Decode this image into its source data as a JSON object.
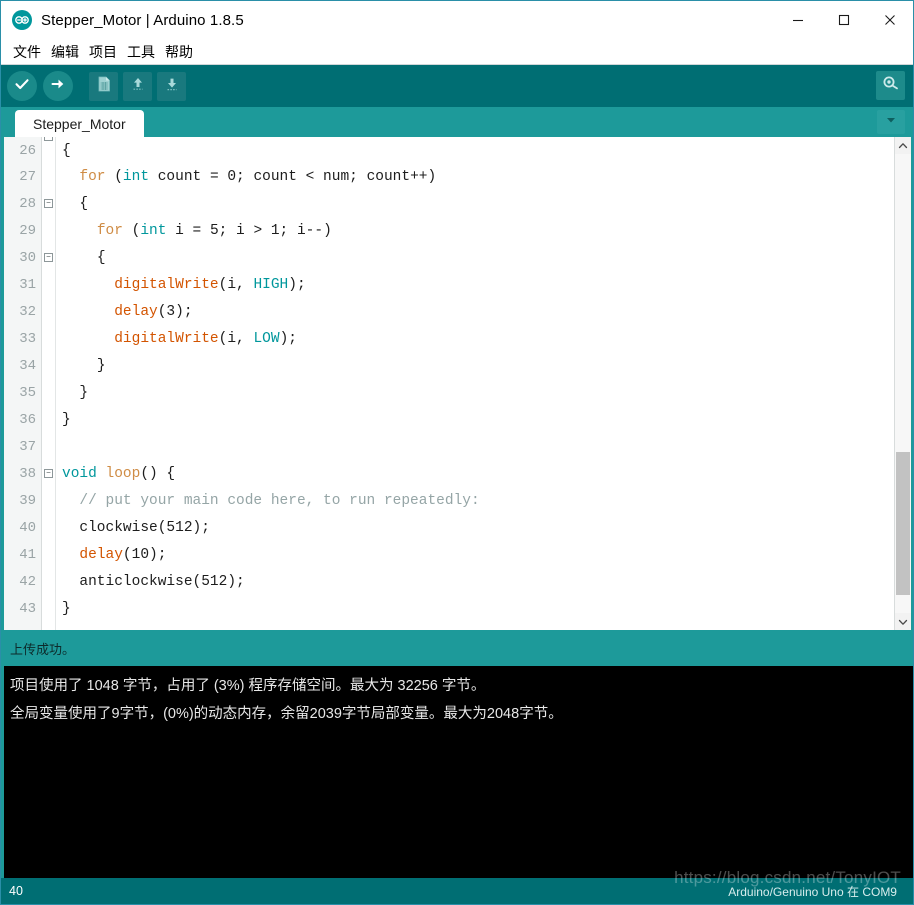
{
  "window": {
    "title": "Stepper_Motor | Arduino 1.8.5",
    "app_icon": "arduino-logo-icon",
    "minimize_label": "—",
    "maximize_label": "□",
    "close_label": "✕"
  },
  "colors": {
    "accent_teal": "#006e73",
    "tab_teal": "#1d9a9a",
    "console_bg": "#000000",
    "keyword": "#cf8c45",
    "type": "#00979c",
    "function": "#d35400",
    "comment": "#95a5a6"
  },
  "menubar": {
    "items": [
      {
        "label": "文件",
        "name": "menu-file"
      },
      {
        "label": "编辑",
        "name": "menu-edit"
      },
      {
        "label": "项目",
        "name": "menu-sketch"
      },
      {
        "label": "工具",
        "name": "menu-tools"
      },
      {
        "label": "帮助",
        "name": "menu-help"
      }
    ]
  },
  "toolbar": {
    "verify_icon": "check-icon",
    "upload_icon": "arrow-right-icon",
    "new_icon": "new-file-icon",
    "open_icon": "arrow-up-icon",
    "save_icon": "arrow-down-icon",
    "serial_monitor_icon": "magnifier-icon"
  },
  "tabs": {
    "active": "Stepper_Motor",
    "items": [
      {
        "label": "Stepper_Motor"
      }
    ],
    "dropdown_icon": "chevron-down-icon"
  },
  "editor": {
    "first_visible_line": 26,
    "lines": [
      {
        "num": "26",
        "fold": true,
        "partial": true,
        "tokens": [
          {
            "t": "{",
            "c": "k-plain"
          }
        ],
        "indent": 0
      },
      {
        "num": "27",
        "fold": false,
        "tokens": [
          {
            "t": "for",
            "c": "k-kw"
          },
          {
            "t": " (",
            "c": "k-plain"
          },
          {
            "t": "int",
            "c": "k-type"
          },
          {
            "t": " count = 0; count < num; count++)",
            "c": "k-plain"
          }
        ],
        "indent": 2
      },
      {
        "num": "28",
        "fold": true,
        "tokens": [
          {
            "t": "{",
            "c": "k-plain"
          }
        ],
        "indent": 2
      },
      {
        "num": "29",
        "fold": false,
        "tokens": [
          {
            "t": "for",
            "c": "k-kw"
          },
          {
            "t": " (",
            "c": "k-plain"
          },
          {
            "t": "int",
            "c": "k-type"
          },
          {
            "t": " i = 5; i > 1; i--)",
            "c": "k-plain"
          }
        ],
        "indent": 4
      },
      {
        "num": "30",
        "fold": true,
        "tokens": [
          {
            "t": "{",
            "c": "k-plain"
          }
        ],
        "indent": 4
      },
      {
        "num": "31",
        "fold": false,
        "tokens": [
          {
            "t": "digitalWrite",
            "c": "k-fn"
          },
          {
            "t": "(i, ",
            "c": "k-plain"
          },
          {
            "t": "HIGH",
            "c": "k-const"
          },
          {
            "t": ");",
            "c": "k-plain"
          }
        ],
        "indent": 6
      },
      {
        "num": "32",
        "fold": false,
        "tokens": [
          {
            "t": "delay",
            "c": "k-fn"
          },
          {
            "t": "(3);",
            "c": "k-plain"
          }
        ],
        "indent": 6
      },
      {
        "num": "33",
        "fold": false,
        "tokens": [
          {
            "t": "digitalWrite",
            "c": "k-fn"
          },
          {
            "t": "(i, ",
            "c": "k-plain"
          },
          {
            "t": "LOW",
            "c": "k-const"
          },
          {
            "t": ");",
            "c": "k-plain"
          }
        ],
        "indent": 6
      },
      {
        "num": "34",
        "fold": false,
        "tokens": [
          {
            "t": "}",
            "c": "k-plain"
          }
        ],
        "indent": 4
      },
      {
        "num": "35",
        "fold": false,
        "tokens": [
          {
            "t": "}",
            "c": "k-plain"
          }
        ],
        "indent": 2
      },
      {
        "num": "36",
        "fold": false,
        "tokens": [
          {
            "t": "}",
            "c": "k-plain"
          }
        ],
        "indent": 0
      },
      {
        "num": "37",
        "fold": false,
        "tokens": [],
        "indent": 0
      },
      {
        "num": "38",
        "fold": true,
        "tokens": [
          {
            "t": "void",
            "c": "k-type"
          },
          {
            "t": " ",
            "c": "k-plain"
          },
          {
            "t": "loop",
            "c": "k-kw"
          },
          {
            "t": "() {",
            "c": "k-plain"
          }
        ],
        "indent": 0
      },
      {
        "num": "39",
        "fold": false,
        "tokens": [
          {
            "t": "// put your main code here, to run repeatedly:",
            "c": "k-comment"
          }
        ],
        "indent": 2
      },
      {
        "num": "40",
        "fold": false,
        "tokens": [
          {
            "t": "clockwise(512);",
            "c": "k-plain"
          }
        ],
        "indent": 2
      },
      {
        "num": "41",
        "fold": false,
        "tokens": [
          {
            "t": "delay",
            "c": "k-fn"
          },
          {
            "t": "(10);",
            "c": "k-plain"
          }
        ],
        "indent": 2
      },
      {
        "num": "42",
        "fold": false,
        "tokens": [
          {
            "t": "anticlockwise(512);",
            "c": "k-plain"
          }
        ],
        "indent": 2
      },
      {
        "num": "43",
        "fold": false,
        "tokens": [
          {
            "t": "}",
            "c": "k-plain"
          }
        ],
        "indent": 0
      }
    ]
  },
  "status_message": "上传成功。",
  "console": {
    "lines": [
      "项目使用了 1048 字节，占用了 (3%) 程序存储空间。最大为 32256 字节。",
      "全局变量使用了9字节，(0%)的动态内存，余留2039字节局部变量。最大为2048字节。"
    ]
  },
  "bottombar": {
    "line_number": "40",
    "board_info": "Arduino/Genuino Uno 在 COM9"
  },
  "watermark": "https://blog.csdn.net/TonyIOT"
}
